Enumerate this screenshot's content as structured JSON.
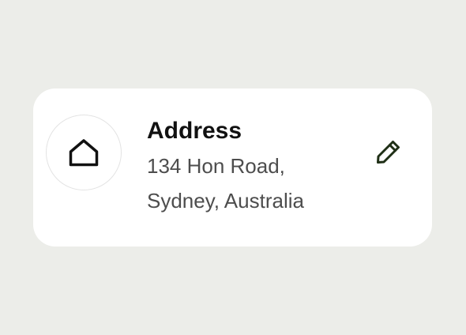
{
  "card": {
    "title": "Address",
    "address_line_1": "134 Hon Road,",
    "address_line_2": "Sydney, Australia",
    "icon": "home-icon",
    "edit_icon": "pencil-icon"
  },
  "colors": {
    "background": "#ecede9",
    "card": "#ffffff",
    "title": "#111111",
    "body_text": "#4d4d4d",
    "edit_icon": "#1f2f16"
  }
}
